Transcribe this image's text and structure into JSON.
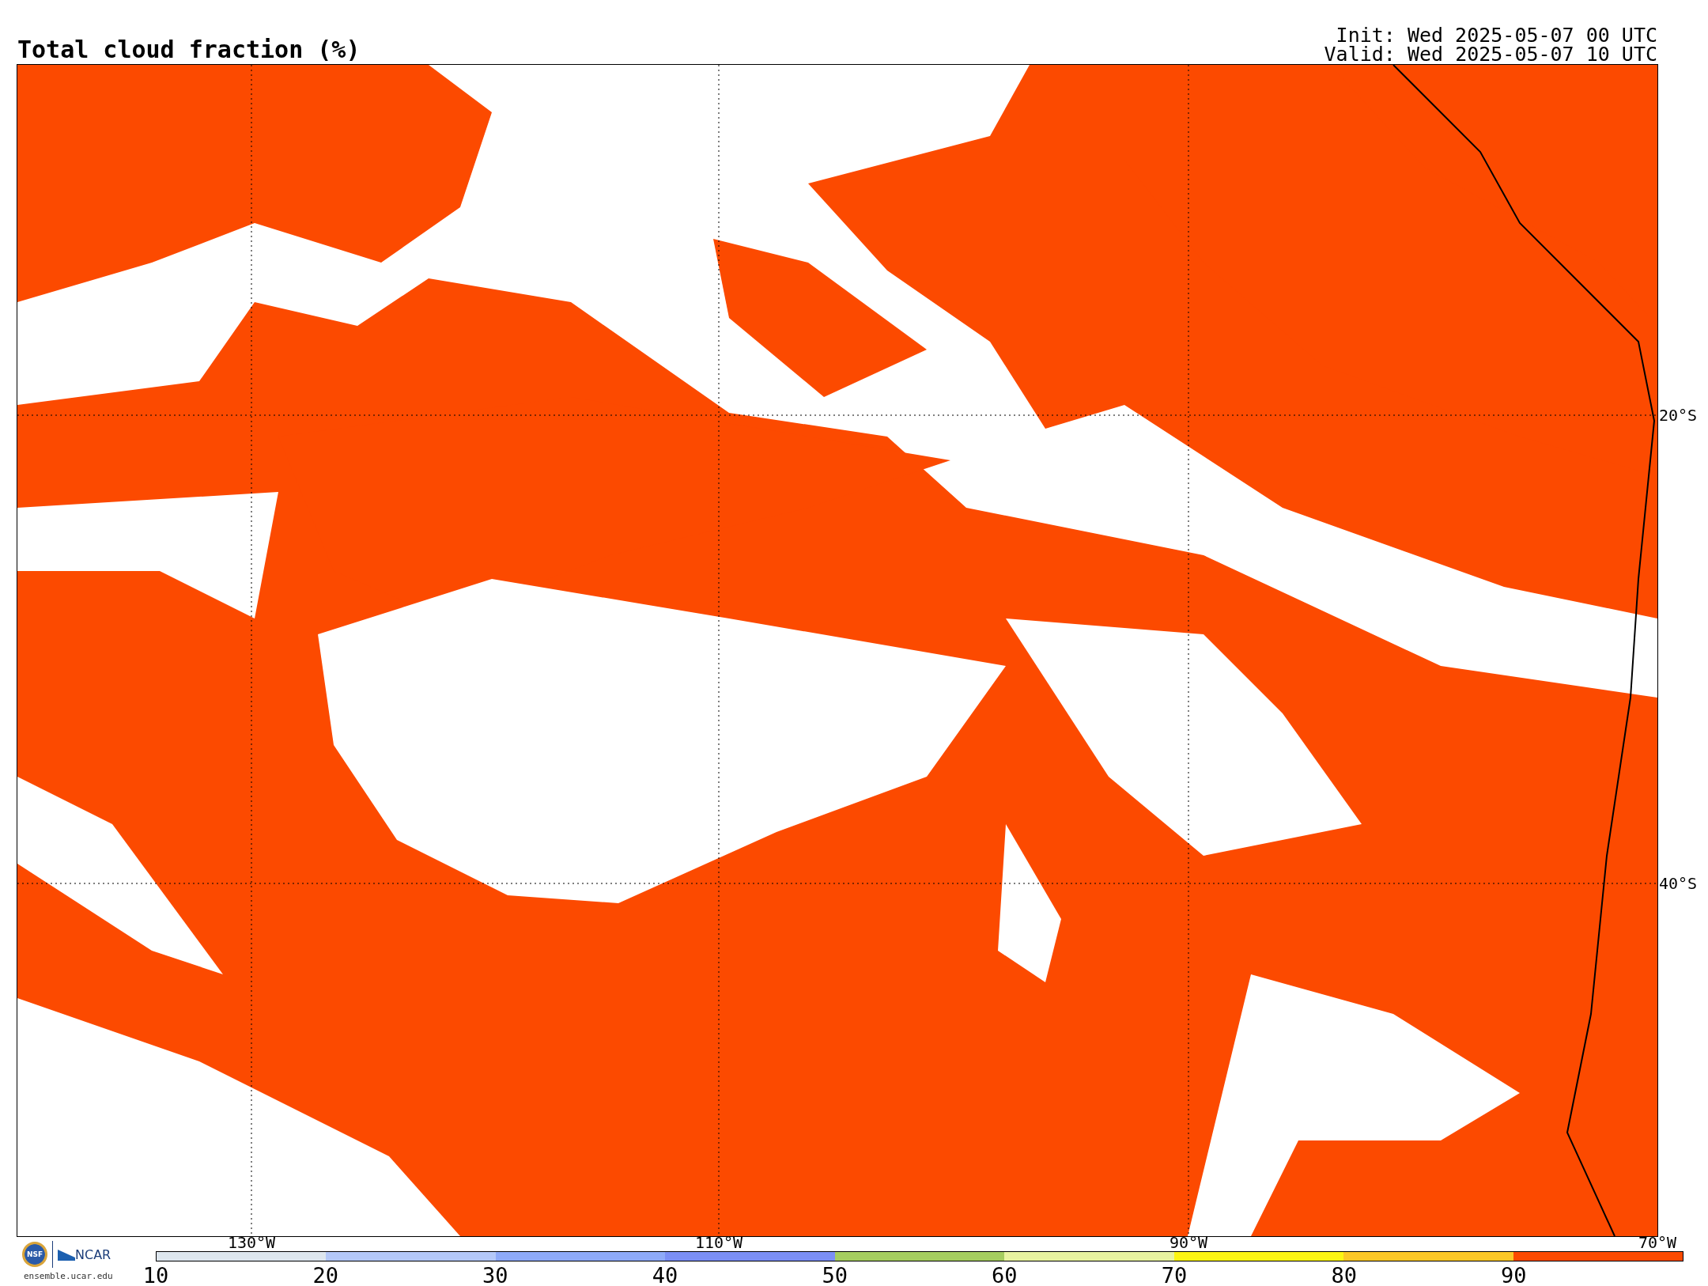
{
  "title": "Total cloud fraction (%)",
  "init": "Init: Wed 2025-05-07 00 UTC",
  "valid": "Valid: Wed 2025-05-07 10 UTC",
  "map": {
    "lat_labels": [
      "20°S",
      "40°S"
    ],
    "lon_labels": [
      "130°W",
      "110°W",
      "90°W",
      "70°W"
    ]
  },
  "colorbar": {
    "bins": [
      {
        "color": "#dde6ee"
      },
      {
        "color": "#b4c8f8"
      },
      {
        "color": "#8eaaf8"
      },
      {
        "color": "#7b8ff5"
      },
      {
        "color": "#a5cd60"
      },
      {
        "color": "#e8f3a0"
      },
      {
        "color": "#fcf513"
      },
      {
        "color": "#fcc827"
      },
      {
        "color": "#fc4a00"
      }
    ],
    "labels": [
      "10",
      "20",
      "30",
      "40",
      "50",
      "60",
      "70",
      "80",
      "90"
    ]
  },
  "logo": {
    "nsf": "NSF",
    "ncar": "NCAR",
    "url": "ensemble.ucar.edu"
  }
}
